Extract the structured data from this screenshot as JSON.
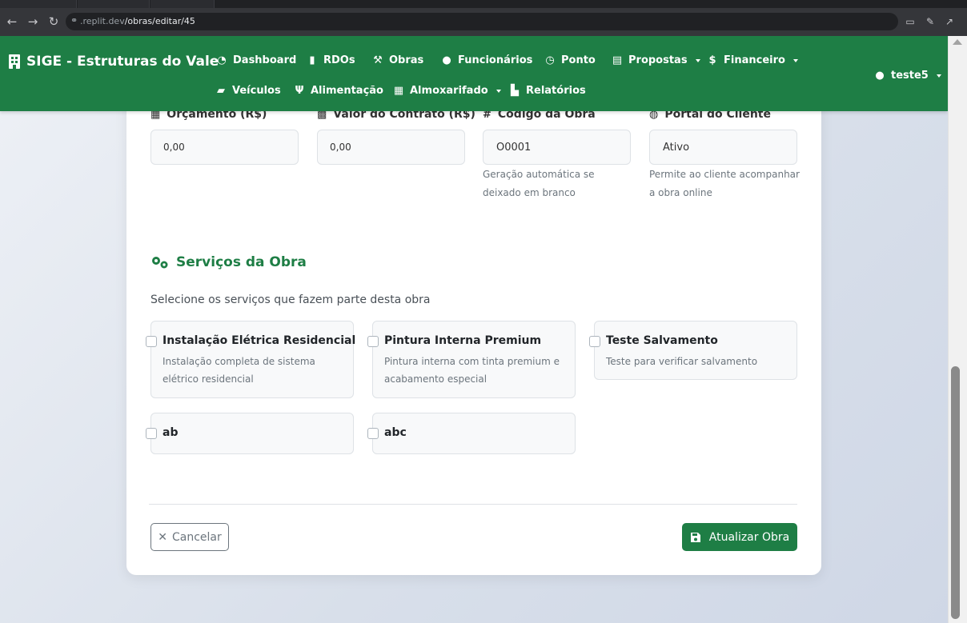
{
  "browser": {
    "url_host": ".replit.dev",
    "url_path": "/obras/editar/45"
  },
  "colors": {
    "brand": "#1e7e45",
    "muted": "#6c757d"
  },
  "navbar": {
    "brand": "SIGE - Estruturas do Vale",
    "items": [
      {
        "label": "Dashboard",
        "icon": "gauge-icon"
      },
      {
        "label": "RDOs",
        "icon": "clipboard-icon"
      },
      {
        "label": "Obras",
        "icon": "hammer-icon"
      },
      {
        "label": "Funcionários",
        "icon": "users-icon"
      },
      {
        "label": "Ponto",
        "icon": "clock-icon"
      },
      {
        "label": "Propostas",
        "icon": "file-icon"
      },
      {
        "label": "Financeiro",
        "icon": "dollar-icon"
      },
      {
        "label": "Veículos",
        "icon": "car-icon"
      },
      {
        "label": "Alimentação",
        "icon": "utensils-icon"
      },
      {
        "label": "Almoxarifado",
        "icon": "boxes-icon"
      },
      {
        "label": "Relatórios",
        "icon": "chart-icon"
      }
    ],
    "user": "teste5"
  },
  "fields": {
    "orcamento": {
      "label": "Orçamento (R$)",
      "value": "0,00"
    },
    "valor_contrato": {
      "label": "Valor do Contrato (R$)",
      "value": "0,00"
    },
    "codigo": {
      "label": "Código da Obra",
      "value": "O0001",
      "help": "Geração automática se deixado em branco"
    },
    "portal": {
      "label": "Portal do Cliente",
      "value": "Ativo",
      "help": "Permite ao cliente acompanhar a obra online"
    }
  },
  "services": {
    "title": "Serviços da Obra",
    "subtitle": "Selecione os serviços que fazem parte desta obra",
    "items": [
      {
        "name": "Instalação Elétrica Residencial",
        "desc": "Instalação completa de sistema elétrico residencial"
      },
      {
        "name": "Pintura Interna Premium",
        "desc": "Pintura interna com tinta premium e acabamento especial"
      },
      {
        "name": "Teste Salvamento",
        "desc": "Teste para verificar salvamento"
      },
      {
        "name": "ab",
        "desc": ""
      },
      {
        "name": "abc",
        "desc": ""
      }
    ]
  },
  "actions": {
    "cancel": "Cancelar",
    "save": "Atualizar Obra"
  }
}
